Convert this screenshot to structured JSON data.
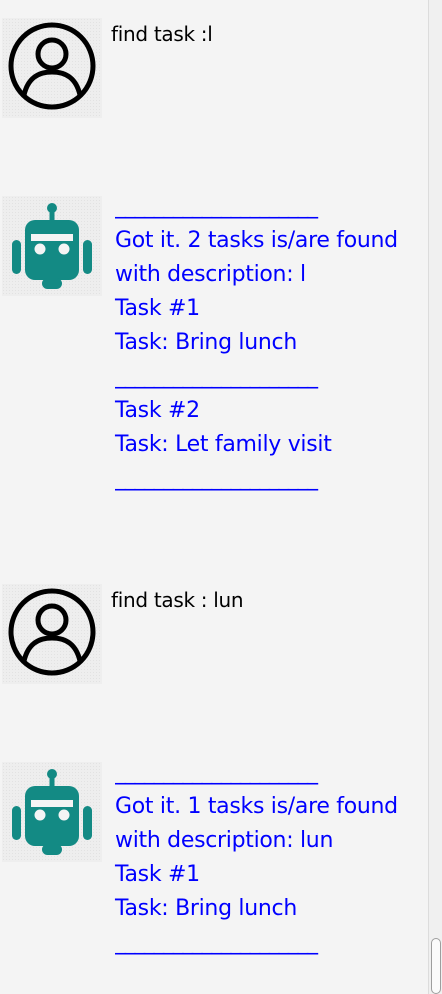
{
  "colors": {
    "background": "#f4f4f4",
    "bot_text": "#0000ff",
    "user_text": "#000000",
    "bot_icon": "#138a84"
  },
  "messages": [
    {
      "sender": "user",
      "avatar_icon": "user-circle-icon",
      "text": "find task :l"
    },
    {
      "sender": "bot",
      "avatar_icon": "android-robot-icon",
      "lines": [
        "_____________________",
        "Got it. 2 tasks is/are found",
        "with description: l",
        "Task #1",
        "Task: Bring lunch",
        "_____________________",
        "Task #2",
        "Task: Let family visit",
        "_____________________"
      ]
    },
    {
      "sender": "user",
      "avatar_icon": "user-circle-icon",
      "text": "find task : lun"
    },
    {
      "sender": "bot",
      "avatar_icon": "android-robot-icon",
      "lines": [
        "_____________________",
        "Got it. 1 tasks is/are found",
        "with description: lun",
        "Task #1",
        "Task: Bring lunch",
        "_____________________"
      ]
    }
  ]
}
